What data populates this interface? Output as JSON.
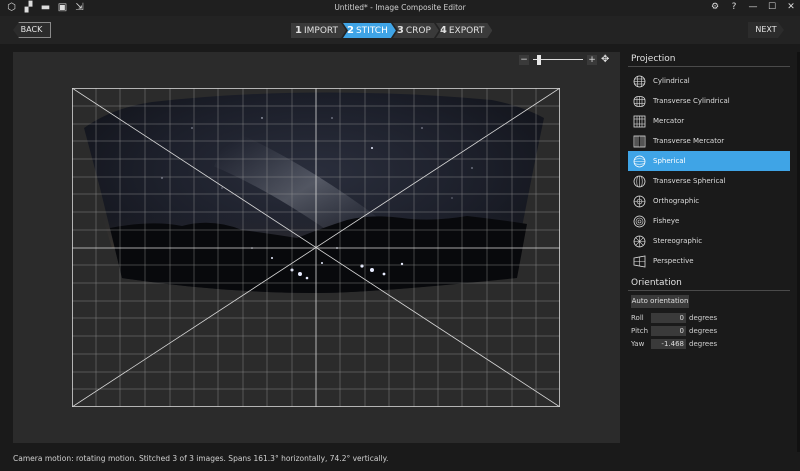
{
  "window": {
    "title": "Untitled* - Image Composite Editor",
    "toolbar_icons": [
      "new-project-icon",
      "new-panorama-icon",
      "open-icon",
      "save-icon",
      "export-icon"
    ],
    "controls": [
      "settings-icon",
      "help-icon",
      "minimize-icon",
      "maximize-icon",
      "close-icon"
    ]
  },
  "nav": {
    "back_label": "BACK",
    "next_label": "NEXT",
    "steps": [
      {
        "num": "1",
        "label": "IMPORT",
        "active": false
      },
      {
        "num": "2",
        "label": "STITCH",
        "active": true
      },
      {
        "num": "3",
        "label": "CROP",
        "active": false
      },
      {
        "num": "4",
        "label": "EXPORT",
        "active": false
      }
    ]
  },
  "zoom": {
    "minus": "−",
    "plus": "+",
    "level": 0.08
  },
  "projection": {
    "title": "Projection",
    "items": [
      {
        "label": "Cylindrical",
        "icon": "cylindrical-icon",
        "active": false
      },
      {
        "label": "Transverse Cylindrical",
        "icon": "transverse-cylindrical-icon",
        "active": false
      },
      {
        "label": "Mercator",
        "icon": "mercator-icon",
        "active": false
      },
      {
        "label": "Transverse Mercator",
        "icon": "transverse-mercator-icon",
        "active": false
      },
      {
        "label": "Spherical",
        "icon": "spherical-icon",
        "active": true
      },
      {
        "label": "Transverse Spherical",
        "icon": "transverse-spherical-icon",
        "active": false
      },
      {
        "label": "Orthographic",
        "icon": "orthographic-icon",
        "active": false
      },
      {
        "label": "Fisheye",
        "icon": "fisheye-icon",
        "active": false
      },
      {
        "label": "Stereographic",
        "icon": "stereographic-icon",
        "active": false
      },
      {
        "label": "Perspective",
        "icon": "perspective-icon",
        "active": false
      }
    ]
  },
  "orientation": {
    "title": "Orientation",
    "auto_label": "Auto orientation",
    "roll": {
      "label": "Roll",
      "value": "0",
      "unit": "degrees"
    },
    "pitch": {
      "label": "Pitch",
      "value": "0",
      "unit": "degrees"
    },
    "yaw": {
      "label": "Yaw",
      "value": "-1.468",
      "unit": "degrees"
    }
  },
  "status": "Camera motion: rotating motion. Stitched 3 of 3 images. Spans 161.3° horizontally, 74.2° vertically.",
  "colors": {
    "accent": "#3fa4e6"
  }
}
